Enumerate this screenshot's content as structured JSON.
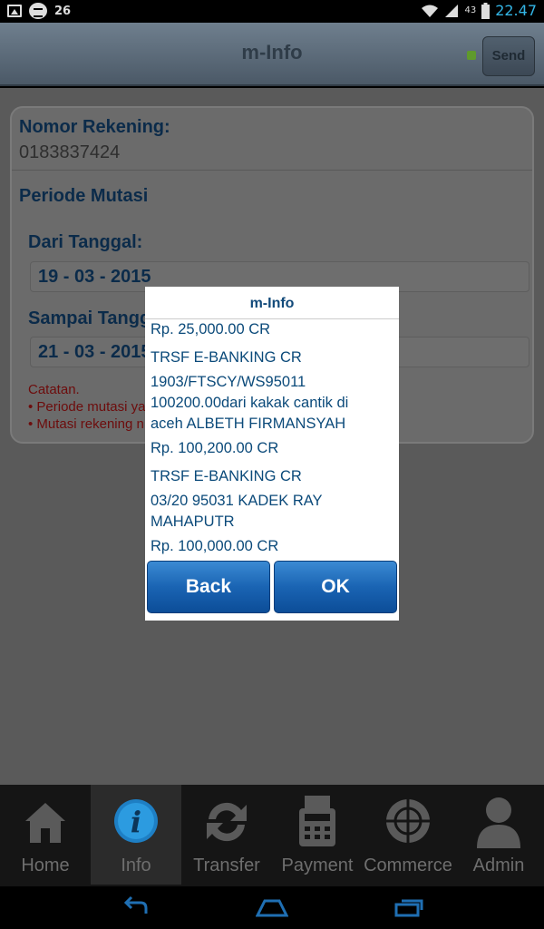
{
  "status_bar": {
    "temperature": "26",
    "network": "43",
    "time": "22.47",
    "colors": {
      "time": "#33b5e5"
    },
    "icons": [
      "image-icon",
      "chat-icon",
      "wifi-icon",
      "signal-icon",
      "battery-icon"
    ]
  },
  "header": {
    "title": "m-Info",
    "send_label": "Send",
    "colors": {
      "indicator": "#5f9a2c"
    }
  },
  "form": {
    "account_label": "Nomor Rekening:",
    "account_number": "0183837424",
    "period_label": "Periode Mutasi",
    "from_label": "Dari Tanggal:",
    "from_date": "19 - 03 - 2015",
    "to_label": "Sampai Tangg",
    "to_date": "21 - 03 - 2015",
    "notes": {
      "title": "Catatan.",
      "items": [
        "• Periode mutasi ya",
        "• Mutasi rekening n"
      ]
    }
  },
  "dialog": {
    "title": "m-Info",
    "lines": [
      "Rp. 25,000.00 CR",
      "TRSF E-BANKING CR",
      "1903/FTSCY/WS95011",
      "100200.00dari kakak cantik di",
      "aceh ALBETH FIRMANSYAH",
      "Rp. 100,200.00 CR",
      "TRSF E-BANKING CR",
      "03/20 95031 KADEK RAY",
      "MAHAPUTR",
      "Rp. 100,000.00 CR"
    ],
    "back_label": "Back",
    "ok_label": "OK",
    "colors": {
      "text": "#0b4a7a",
      "button": "#1a64b3"
    }
  },
  "tabs": [
    {
      "label": "Home",
      "icon": "home-icon",
      "active": false
    },
    {
      "label": "Info",
      "icon": "info-icon",
      "active": true
    },
    {
      "label": "Transfer",
      "icon": "transfer-icon",
      "active": false
    },
    {
      "label": "Payment",
      "icon": "payment-icon",
      "active": false
    },
    {
      "label": "Commerce",
      "icon": "commerce-icon",
      "active": false
    },
    {
      "label": "Admin",
      "icon": "admin-icon",
      "active": false
    }
  ],
  "nav": {
    "icons": [
      "back-icon",
      "home-nav-icon",
      "recents-icon"
    ]
  }
}
